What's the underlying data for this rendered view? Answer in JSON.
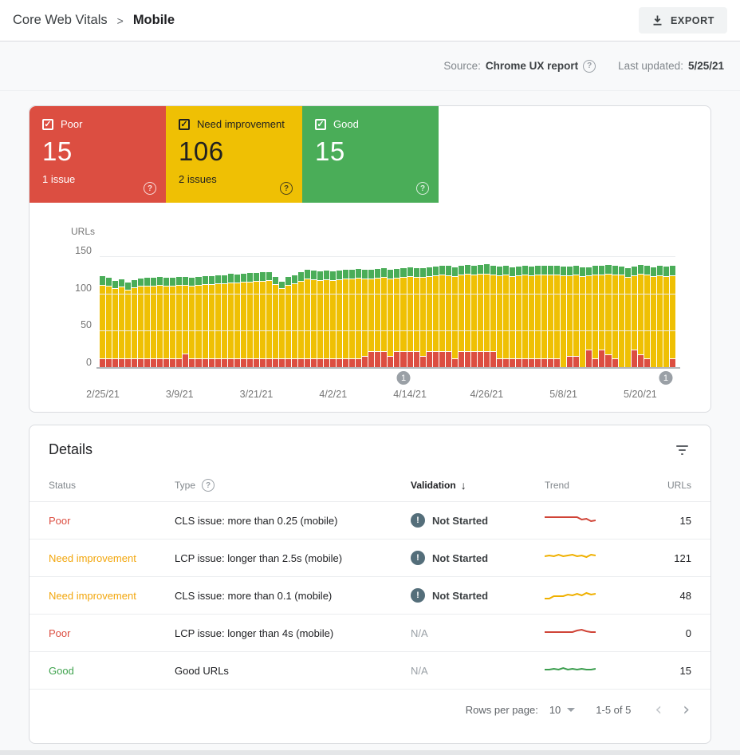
{
  "header": {
    "breadcrumb_root": "Core Web Vitals",
    "breadcrumb_separator": ">",
    "breadcrumb_current": "Mobile",
    "export_label": "EXPORT"
  },
  "meta": {
    "source_label": "Source:",
    "source_value": "Chrome UX report",
    "updated_label": "Last updated:",
    "updated_value": "5/25/21"
  },
  "cards": [
    {
      "label": "Poor",
      "count": "15",
      "issues": "1 issue",
      "color": "#dc4e41",
      "text_color": "#ffffff"
    },
    {
      "label": "Need improvement",
      "count": "106",
      "issues": "2 issues",
      "color": "#efc004",
      "text_color": "#212121"
    },
    {
      "label": "Good",
      "count": "15",
      "issues": "",
      "color": "#4aad58",
      "text_color": "#ffffff"
    }
  ],
  "chart_data": {
    "type": "bar",
    "stacked": true,
    "title": "Core Web Vitals - Mobile URLs over time",
    "ylabel": "URLs",
    "ylim": [
      0,
      150
    ],
    "yticks": [
      150,
      100,
      50,
      0
    ],
    "grid": true,
    "x_tick_labels": [
      "2/25/21",
      "3/9/21",
      "3/21/21",
      "4/2/21",
      "4/14/21",
      "4/26/21",
      "5/8/21",
      "5/20/21"
    ],
    "x_tick_day_interval": 12,
    "series_names": [
      "Poor",
      "Need improvement",
      "Good"
    ],
    "colors": {
      "poor": "#dc4e41",
      "need_improvement": "#efc004",
      "good": "#4aad58"
    },
    "markers": [
      {
        "label": "1",
        "index": 47
      },
      {
        "label": "1",
        "index": 88
      }
    ],
    "bars_note": "per-day stacked values [poor, need_improvement, good]",
    "bars": [
      [
        13,
        99,
        13
      ],
      [
        13,
        97,
        12
      ],
      [
        13,
        94,
        11
      ],
      [
        13,
        96,
        11
      ],
      [
        13,
        92,
        11
      ],
      [
        13,
        95,
        11
      ],
      [
        13,
        97,
        11
      ],
      [
        13,
        98,
        12
      ],
      [
        13,
        98,
        12
      ],
      [
        13,
        99,
        12
      ],
      [
        13,
        97,
        12
      ],
      [
        13,
        98,
        12
      ],
      [
        13,
        99,
        12
      ],
      [
        19,
        92,
        12
      ],
      [
        13,
        97,
        12
      ],
      [
        13,
        99,
        12
      ],
      [
        13,
        100,
        12
      ],
      [
        13,
        100,
        12
      ],
      [
        13,
        101,
        12
      ],
      [
        13,
        101,
        12
      ],
      [
        13,
        102,
        13
      ],
      [
        13,
        102,
        12
      ],
      [
        13,
        103,
        12
      ],
      [
        13,
        103,
        13
      ],
      [
        13,
        104,
        12
      ],
      [
        13,
        104,
        13
      ],
      [
        13,
        105,
        12
      ],
      [
        13,
        100,
        11
      ],
      [
        13,
        94,
        10
      ],
      [
        13,
        99,
        12
      ],
      [
        13,
        101,
        12
      ],
      [
        13,
        104,
        13
      ],
      [
        13,
        107,
        13
      ],
      [
        13,
        106,
        13
      ],
      [
        13,
        105,
        13
      ],
      [
        13,
        106,
        13
      ],
      [
        13,
        105,
        13
      ],
      [
        13,
        106,
        13
      ],
      [
        13,
        107,
        13
      ],
      [
        13,
        107,
        13
      ],
      [
        13,
        108,
        13
      ],
      [
        16,
        104,
        13
      ],
      [
        22,
        98,
        13
      ],
      [
        22,
        99,
        13
      ],
      [
        22,
        100,
        13
      ],
      [
        16,
        104,
        13
      ],
      [
        22,
        99,
        13
      ],
      [
        22,
        100,
        13
      ],
      [
        22,
        101,
        13
      ],
      [
        22,
        100,
        13
      ],
      [
        16,
        106,
        13
      ],
      [
        22,
        101,
        13
      ],
      [
        22,
        102,
        13
      ],
      [
        22,
        103,
        13
      ],
      [
        22,
        102,
        14
      ],
      [
        13,
        110,
        13
      ],
      [
        22,
        103,
        13
      ],
      [
        22,
        104,
        13
      ],
      [
        22,
        103,
        13
      ],
      [
        22,
        104,
        13
      ],
      [
        22,
        104,
        14
      ],
      [
        22,
        103,
        13
      ],
      [
        13,
        111,
        13
      ],
      [
        13,
        112,
        13
      ],
      [
        13,
        110,
        13
      ],
      [
        13,
        111,
        13
      ],
      [
        13,
        112,
        13
      ],
      [
        13,
        111,
        13
      ],
      [
        13,
        112,
        13
      ],
      [
        13,
        113,
        13
      ],
      [
        13,
        112,
        13
      ],
      [
        13,
        113,
        13
      ],
      [
        0,
        124,
        13
      ],
      [
        16,
        108,
        13
      ],
      [
        16,
        109,
        13
      ],
      [
        0,
        123,
        13
      ],
      [
        25,
        100,
        12
      ],
      [
        13,
        112,
        13
      ],
      [
        25,
        101,
        13
      ],
      [
        18,
        108,
        13
      ],
      [
        13,
        113,
        13
      ],
      [
        0,
        125,
        12
      ],
      [
        0,
        122,
        13
      ],
      [
        25,
        100,
        13
      ],
      [
        18,
        108,
        13
      ],
      [
        13,
        112,
        13
      ],
      [
        0,
        123,
        13
      ],
      [
        0,
        124,
        14
      ],
      [
        0,
        123,
        14
      ],
      [
        13,
        111,
        14
      ]
    ]
  },
  "details": {
    "title": "Details",
    "columns": {
      "status": "Status",
      "type": "Type",
      "validation": "Validation",
      "trend": "Trend",
      "urls": "URLs"
    },
    "sort_arrow": "↓",
    "rows": [
      {
        "status": "Poor",
        "status_color": "#dc4e41",
        "type": "CLS issue: more than 0.25 (mobile)",
        "validation": "Not Started",
        "urls": "15",
        "trend_color": "#d04437",
        "spark": [
          5,
          5,
          5,
          5,
          5,
          5,
          5,
          5,
          8,
          7,
          10,
          9
        ]
      },
      {
        "status": "Need improvement",
        "status_color": "#f2a60c",
        "type": "LCP issue: longer than 2.5s (mobile)",
        "validation": "Not Started",
        "urls": "121",
        "trend_color": "#efb000",
        "spark": [
          7,
          6,
          7,
          5,
          7,
          6,
          5,
          7,
          6,
          8,
          5,
          6
        ]
      },
      {
        "status": "Need improvement",
        "status_color": "#f2a60c",
        "type": "CLS issue: more than 0.1 (mobile)",
        "validation": "Not Started",
        "urls": "48",
        "trend_color": "#efb000",
        "spark": [
          13,
          13,
          10,
          10,
          10,
          8,
          9,
          7,
          9,
          6,
          8,
          7
        ]
      },
      {
        "status": "Poor",
        "status_color": "#dc4e41",
        "type": "LCP issue: longer than 4s (mobile)",
        "validation": "N/A",
        "urls": "0",
        "trend_color": "#d04437",
        "spark": [
          8,
          8,
          8,
          8,
          8,
          8,
          8,
          6,
          5,
          7,
          8,
          8
        ]
      },
      {
        "status": "Good",
        "status_color": "#3fa34e",
        "type": "Good URLs",
        "validation": "N/A",
        "urls": "15",
        "trend_color": "#3c9e4f",
        "spark": [
          8,
          8,
          7,
          8,
          6,
          8,
          7,
          8,
          7,
          8,
          8,
          7
        ]
      }
    ],
    "footer": {
      "rows_per_page_label": "Rows per page:",
      "rows_per_page_value": "10",
      "range_label": "1-5 of 5",
      "prev": "‹",
      "next": "›"
    }
  }
}
